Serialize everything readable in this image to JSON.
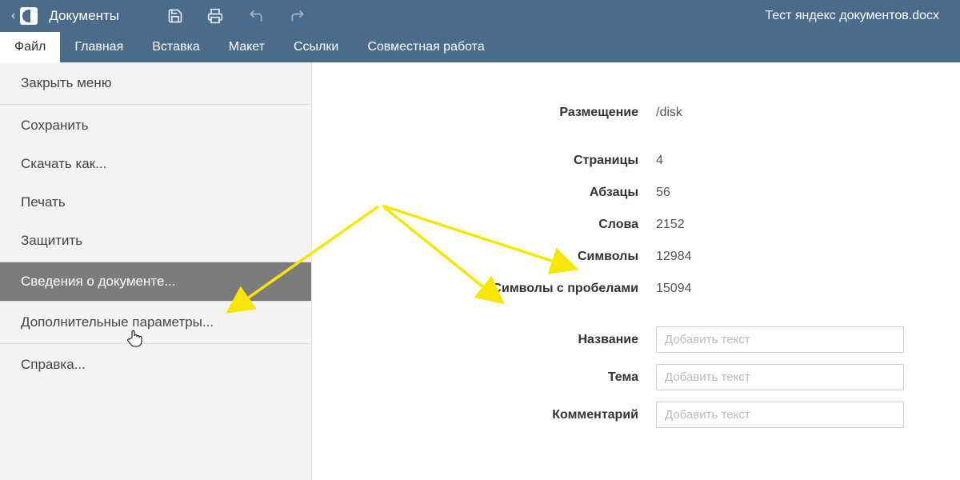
{
  "titlebar": {
    "app_name": "Документы",
    "document_name": "Тест яндекс документов.docx"
  },
  "menubar": {
    "tabs": [
      {
        "label": "Файл",
        "active": true
      },
      {
        "label": "Главная",
        "active": false
      },
      {
        "label": "Вставка",
        "active": false
      },
      {
        "label": "Макет",
        "active": false
      },
      {
        "label": "Ссылки",
        "active": false
      },
      {
        "label": "Совместная работа",
        "active": false
      }
    ]
  },
  "sidebar": {
    "close_menu": "Закрыть меню",
    "save": "Сохранить",
    "download_as": "Скачать как...",
    "print": "Печать",
    "protect": "Защитить",
    "doc_info": "Сведения о документе...",
    "advanced": "Дополнительные параметры...",
    "help": "Справка..."
  },
  "info": {
    "location_label": "Размещение",
    "location_value": "/disk",
    "pages_label": "Страницы",
    "pages_value": "4",
    "paragraphs_label": "Абзацы",
    "paragraphs_value": "56",
    "words_label": "Слова",
    "words_value": "2152",
    "chars_label": "Символы",
    "chars_value": "12984",
    "chars_sp_label": "Символы с пробелами",
    "chars_sp_value": "15094",
    "title_label": "Название",
    "subject_label": "Тема",
    "comment_label": "Комментарий",
    "placeholder": "Добавить текст"
  }
}
